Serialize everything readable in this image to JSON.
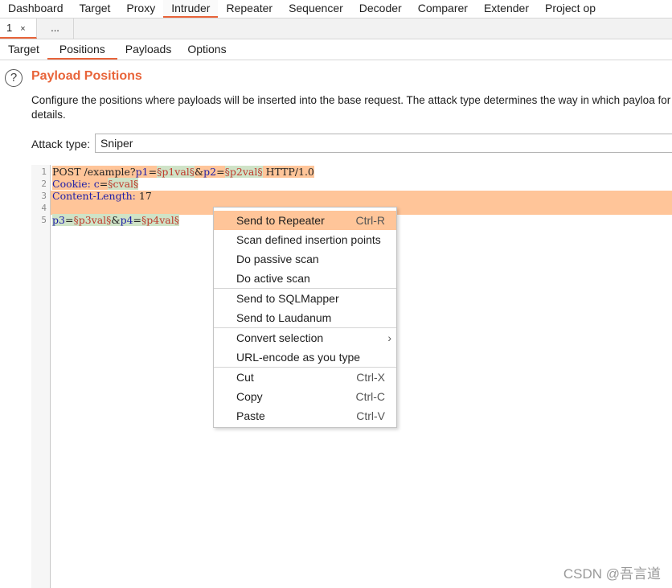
{
  "main_tabs": [
    "Dashboard",
    "Target",
    "Proxy",
    "Intruder",
    "Repeater",
    "Sequencer",
    "Decoder",
    "Comparer",
    "Extender",
    "Project op"
  ],
  "active_main_tab": "Intruder",
  "instance_tabs": {
    "active": "1",
    "close": "×",
    "more": "..."
  },
  "sub_tabs": [
    "Target",
    "Positions",
    "Payloads",
    "Options"
  ],
  "active_sub_tab": "Positions",
  "header": {
    "help": "?",
    "title": "Payload Positions",
    "description": "Configure the positions where payloads will be inserted into the base request. The attack type determines the way in which payloa for full details."
  },
  "attack_type": {
    "label": "Attack type:",
    "value": "Sniper"
  },
  "editor": {
    "line_numbers": [
      "1",
      "2",
      "3",
      "4",
      "5"
    ],
    "line1": {
      "method": "POST /example?",
      "p1": "p1",
      "eq1": "=",
      "pos1": "§p1val§",
      "amp": "&",
      "p2": "p2",
      "eq2": "=",
      "pos2": "§p2val§",
      "tail": " HTTP/1.0"
    },
    "line2": {
      "header": "Cookie: ",
      "name": "c",
      "eq": "=",
      "pos": "§cval§"
    },
    "line3": {
      "header": "Content-Length: ",
      "value": "17"
    },
    "line5": {
      "p3": "p3",
      "eq3": "=",
      "pos3": "§p3val§",
      "amp": "&",
      "p4": "p4",
      "eq4": "=",
      "pos4": "§p4val§"
    }
  },
  "context_menu": {
    "send_to_repeater": "Send to Repeater",
    "send_to_repeater_sc": "Ctrl-R",
    "scan_defined": "Scan defined insertion points",
    "passive_scan": "Do passive scan",
    "active_scan": "Do active scan",
    "send_sqlmapper": "Send to SQLMapper",
    "send_laudanum": "Send to Laudanum",
    "convert_selection": "Convert selection",
    "convert_arrow": "›",
    "url_encode": "URL-encode as you type",
    "cut": "Cut",
    "cut_sc": "Ctrl-X",
    "copy": "Copy",
    "copy_sc": "Ctrl-C",
    "paste": "Paste",
    "paste_sc": "Ctrl-V"
  },
  "watermark": "CSDN @吾言道",
  "colors": {
    "accent": "#e8643a",
    "highlight": "#ffc599",
    "position_marker": "#cfe3c7"
  }
}
